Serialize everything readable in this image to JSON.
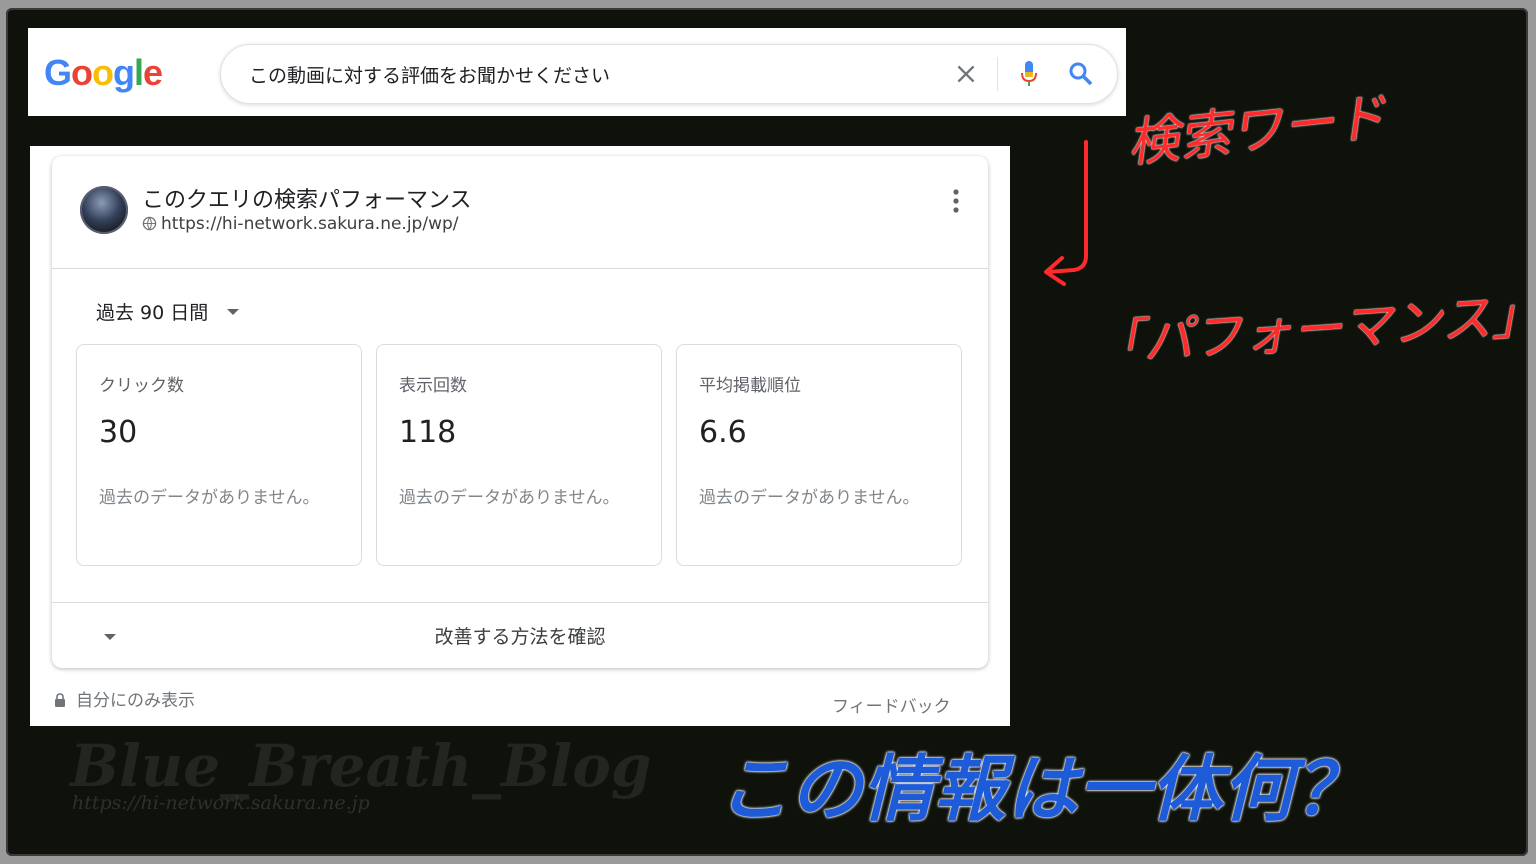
{
  "search": {
    "logo": "Google",
    "query": "この動画に対する評価をお聞かせください"
  },
  "card": {
    "title": "このクエリの検索パフォーマンス",
    "url": "https://hi-network.sakura.ne.jp/wp/",
    "period": "過去 90 日間",
    "metrics": [
      {
        "label": "クリック数",
        "value": "30",
        "note": "過去のデータがありません。"
      },
      {
        "label": "表示回数",
        "value": "118",
        "note": "過去のデータがありません。"
      },
      {
        "label": "平均掲載順位",
        "value": "6.6",
        "note": "過去のデータがありません。"
      }
    ],
    "improve_label": "改善する方法を確認",
    "private_label": "自分にのみ表示",
    "feedback_label": "フィードバック"
  },
  "annotations": {
    "search_word": "検索ワード",
    "performance": "「パフォーマンス」",
    "question": "この情報は一体何？",
    "watermark": "Blue_Breath_Blog",
    "watermark_url": "https://hi-network.sakura.ne.jp"
  },
  "colors": {
    "background": "#0f120b",
    "annotation_red": "#ff2a2a",
    "annotation_blue": "#1e5bd8",
    "google_blue": "#4285f4",
    "google_red": "#ea4335",
    "google_yellow": "#fbbc05",
    "google_green": "#34a853"
  }
}
